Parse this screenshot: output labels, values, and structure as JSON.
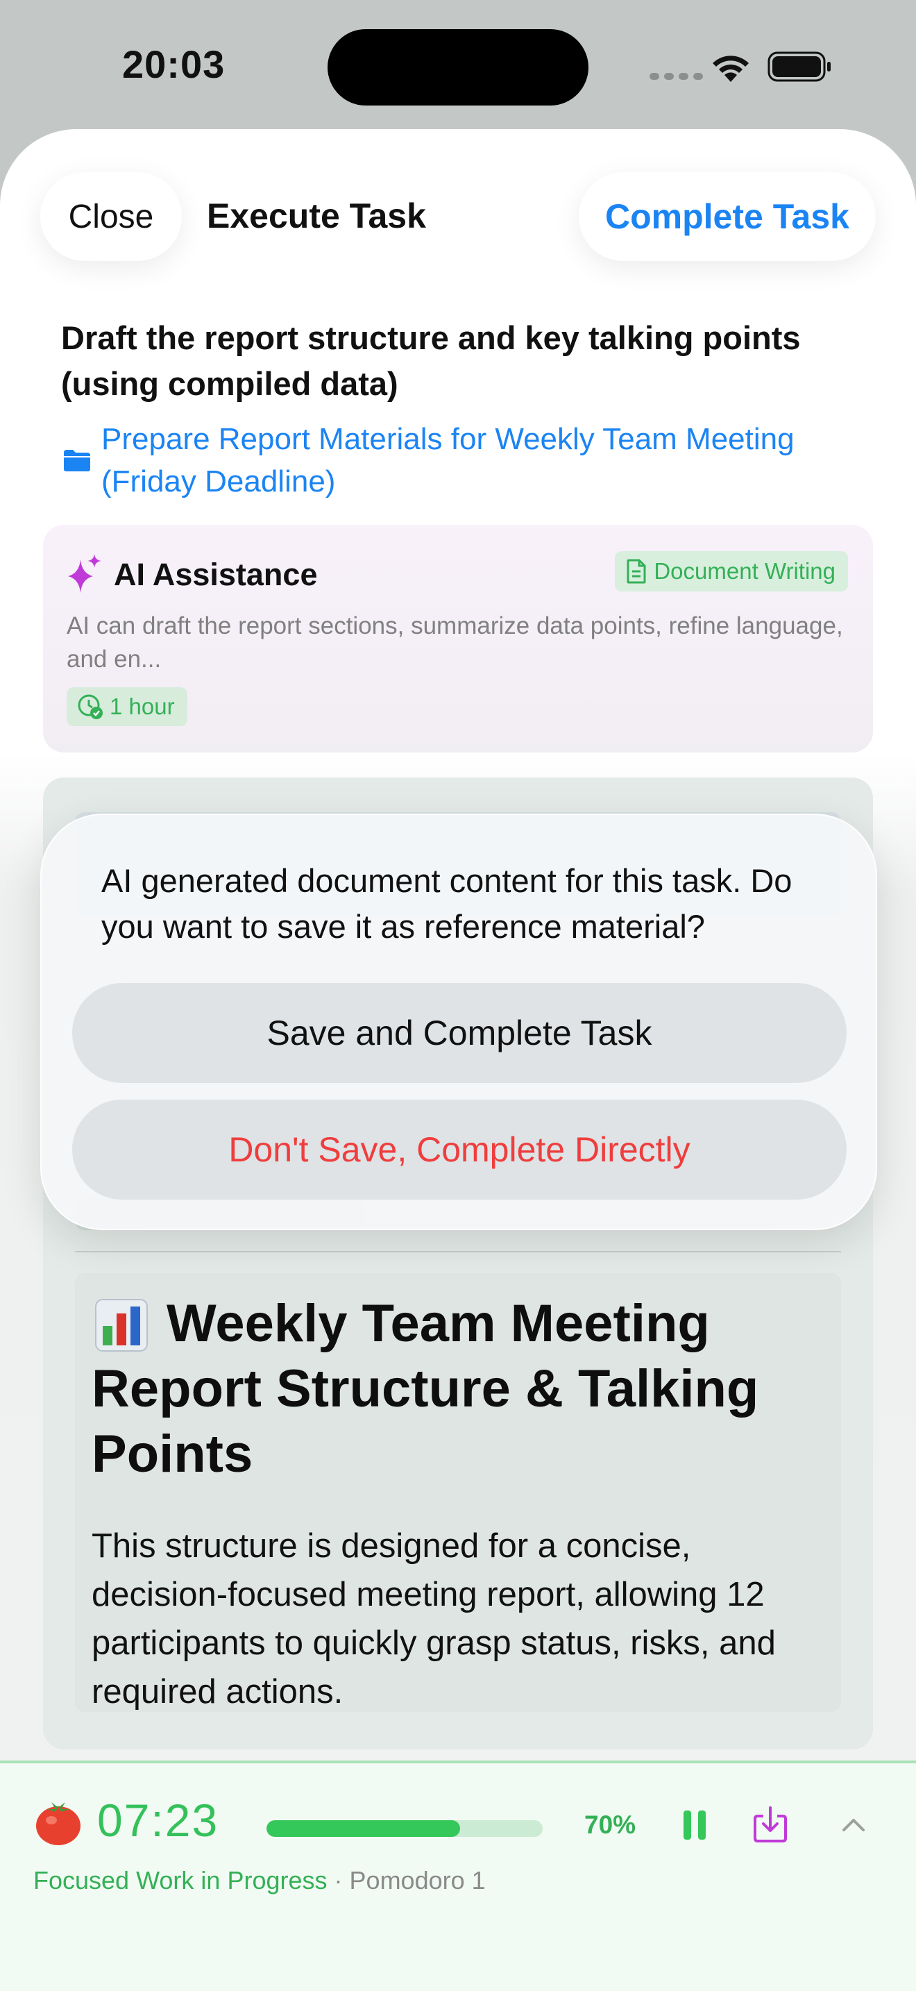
{
  "status_bar": {
    "time": "20:03"
  },
  "header": {
    "close_label": "Close",
    "title": "Execute Task",
    "complete_label": "Complete Task"
  },
  "task": {
    "title": "Draft the report structure and key talking points (using compiled data)",
    "project": "Prepare Report Materials for Weekly Team Meeting (Friday Deadline)"
  },
  "ai_card": {
    "title": "AI Assistance",
    "category": "Document Writing",
    "description": "AI can draft the report sections, summarize data points, refine language, and en...",
    "duration": "1 hour"
  },
  "document": {
    "emoji": "📊",
    "heading": "Weekly Team Meeting Report Structure & Talking Points",
    "body": "This structure is designed for a concise, decision-focused meeting report, allowing 12 participants to quickly grasp status, risks, and required actions."
  },
  "dialog": {
    "message": "AI generated document content for this task. Do you want to save it as reference material?",
    "save_label": "Save and Complete Task",
    "nosave_label": "Don't Save, Complete Directly"
  },
  "pomodoro": {
    "time": "07:23",
    "progress_percent": 70,
    "progress_label": "70%",
    "status": "Focused Work in Progress",
    "separator": "·",
    "session": "Pomodoro 1"
  },
  "colors": {
    "accent_blue": "#1b84f3",
    "pomodoro_green": "#34c759",
    "destructive_red": "#ef3d3d",
    "ai_purple": "#c03ad8"
  }
}
